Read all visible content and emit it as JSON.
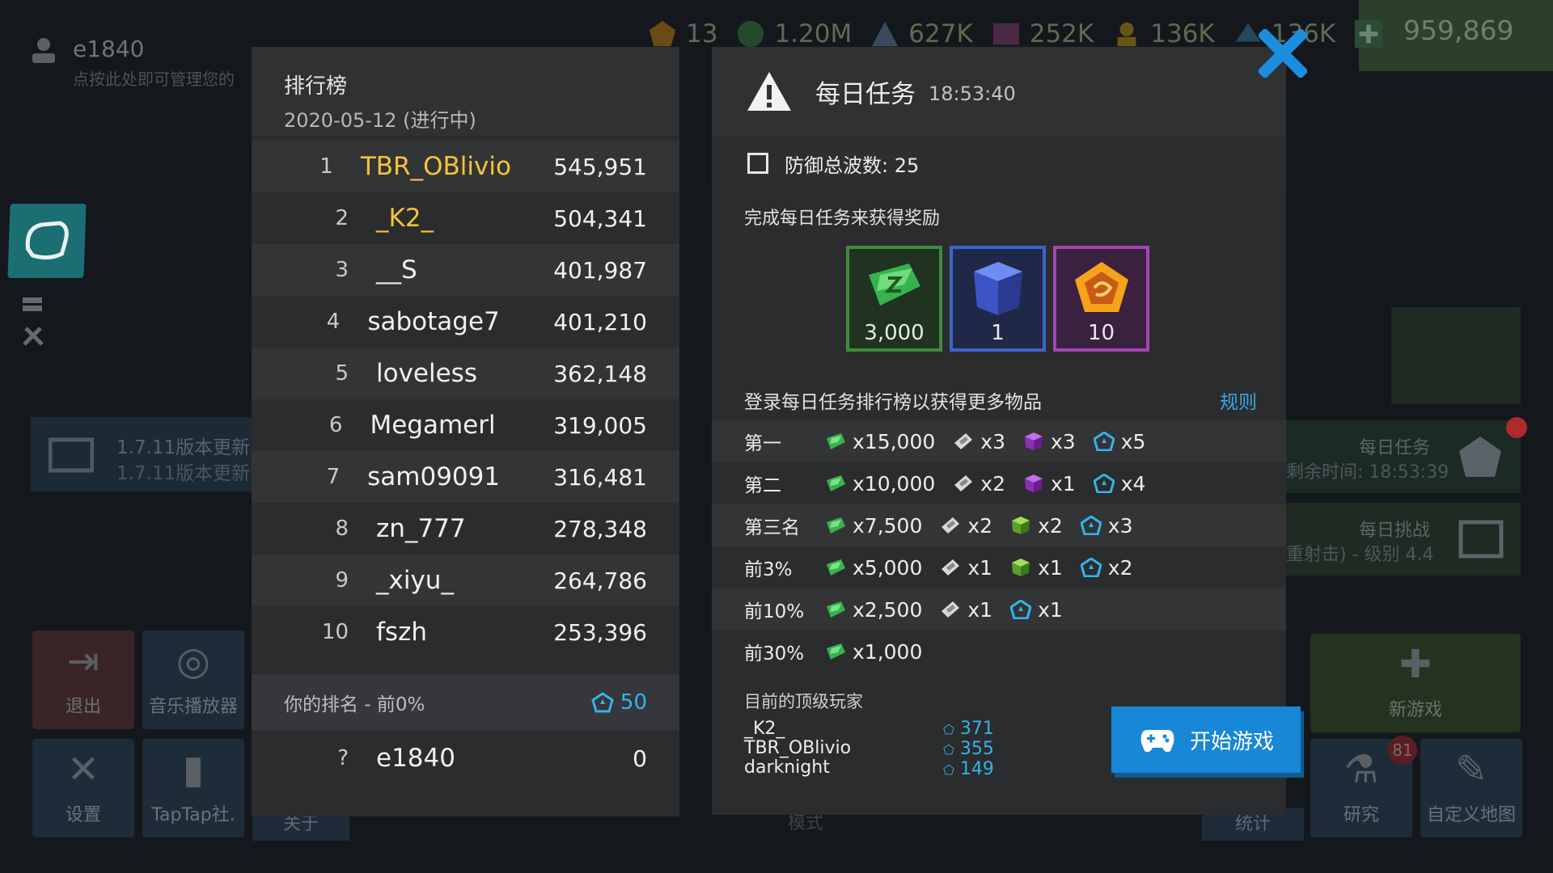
{
  "user": {
    "name": "e1840",
    "hint": "点按此处即可管理您的"
  },
  "resources": [
    {
      "id": "gold-ticket",
      "value": "13"
    },
    {
      "id": "green-coin",
      "value": "1.20M"
    },
    {
      "id": "r3",
      "value": "627K"
    },
    {
      "id": "r4",
      "value": "252K"
    },
    {
      "id": "r5",
      "value": "136K"
    },
    {
      "id": "r6",
      "value": "136K"
    }
  ],
  "money": "959,869",
  "background_menu": {
    "update_title": "1.7.11版本更新",
    "update_sub": "1.7.11版本更新",
    "daily_quest_label": "每日任务",
    "daily_quest_time": "剩余时间: 18:53:39",
    "daily_challenge_label": "每日挑战",
    "daily_challenge_sub": "重射击) - 级别 4.4",
    "tiles": {
      "exit": "退出",
      "music": "音乐播放器",
      "settings": "设置",
      "taptap": "TapTap社.",
      "about": "关于",
      "mode": "模式",
      "stats": "统计",
      "research": "研究",
      "custom_map": "自定义地图",
      "new_game": "新游戏",
      "research_badge": "81"
    }
  },
  "leaderboard": {
    "title": "排行榜",
    "date": "2020-05-12 (进行中)",
    "rows": [
      {
        "rank": "1",
        "name": "TBR_OBlivio",
        "score": "545,951",
        "gold": true
      },
      {
        "rank": "2",
        "name": "_K2_",
        "score": "504,341",
        "gold": true
      },
      {
        "rank": "3",
        "name": "__S",
        "score": "401,987",
        "gold": false
      },
      {
        "rank": "4",
        "name": "sabotage7",
        "score": "401,210",
        "gold": false
      },
      {
        "rank": "5",
        "name": "loveless",
        "score": "362,148",
        "gold": false
      },
      {
        "rank": "6",
        "name": "Megamerl",
        "score": "319,005",
        "gold": false
      },
      {
        "rank": "7",
        "name": "sam09091",
        "score": "316,481",
        "gold": false
      },
      {
        "rank": "8",
        "name": "zn_777",
        "score": "278,348",
        "gold": false
      },
      {
        "rank": "9",
        "name": "_xiyu_",
        "score": "264,786",
        "gold": false
      },
      {
        "rank": "10",
        "name": "fszh",
        "score": "253,396",
        "gold": false
      }
    ],
    "my_rank_label": "你的排名 - 前0%",
    "my_rank_points": "50",
    "my_row": {
      "rank": "?",
      "name": "e1840",
      "score": "0"
    }
  },
  "daily_quest": {
    "title": "每日任务",
    "timer": "18:53:40",
    "task": "防御总波数: 25",
    "reward_label": "完成每日任务来获得奖励",
    "rewards": [
      {
        "icon": "green-paper-icon",
        "amount": "3,000",
        "border": "#3f8a3c",
        "bg": "#1f3320"
      },
      {
        "icon": "blue-crate-icon",
        "amount": "1",
        "border": "#3e64c8",
        "bg": "#1f2846"
      },
      {
        "icon": "gold-pentagon-icon",
        "amount": "10",
        "border": "#a545b4",
        "bg": "#3a2140"
      }
    ],
    "leaderboard_label": "登录每日任务排行榜以获得更多物品",
    "rules": "规则",
    "tiers": [
      {
        "label": "第一",
        "items": [
          [
            "green",
            "x15,000"
          ],
          [
            "ticket",
            "x3"
          ],
          [
            "purple",
            "x3"
          ],
          [
            "cyan",
            "x5"
          ]
        ]
      },
      {
        "label": "第二",
        "items": [
          [
            "green",
            "x10,000"
          ],
          [
            "ticket",
            "x2"
          ],
          [
            "purple",
            "x1"
          ],
          [
            "cyan",
            "x4"
          ]
        ]
      },
      {
        "label": "第三名",
        "items": [
          [
            "green",
            "x7,500"
          ],
          [
            "ticket",
            "x2"
          ],
          [
            "greencube",
            "x2"
          ],
          [
            "cyan",
            "x3"
          ]
        ]
      },
      {
        "label": "前3%",
        "items": [
          [
            "green",
            "x5,000"
          ],
          [
            "ticket",
            "x1"
          ],
          [
            "greencube",
            "x1"
          ],
          [
            "cyan",
            "x2"
          ]
        ]
      },
      {
        "label": "前10%",
        "items": [
          [
            "green",
            "x2,500"
          ],
          [
            "ticket",
            "x1"
          ],
          [
            "cyan",
            "x1"
          ]
        ]
      },
      {
        "label": "前30%",
        "items": [
          [
            "green",
            "x1,000"
          ]
        ]
      }
    ],
    "top_players_label": "目前的顶级玩家",
    "top_players": [
      {
        "name": "_K2_",
        "points": "371"
      },
      {
        "name": "TBR_OBlivio",
        "points": "355"
      },
      {
        "name": "darknight",
        "points": "149"
      }
    ],
    "start_button": "开始游戏"
  },
  "colors": {
    "gold_name": "#f5c33b",
    "accent_blue": "#1787d6",
    "link_blue": "#38a7e0",
    "points_cyan": "#33b4ea"
  }
}
